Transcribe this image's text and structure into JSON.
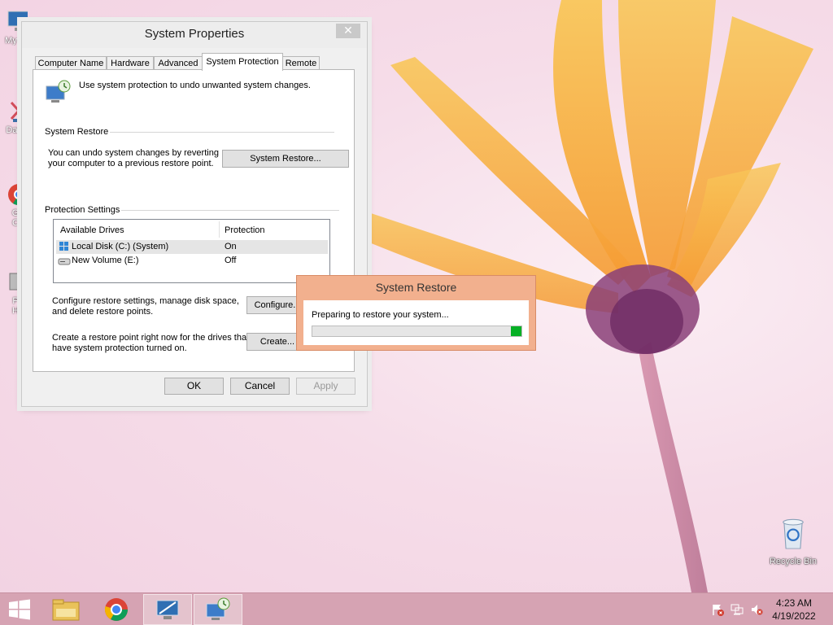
{
  "desktop": {
    "left_icons": [
      "My C",
      "Data",
      "G",
      "C",
      "P",
      "H"
    ],
    "recycle_bin_label": "Recycle Bin"
  },
  "system_properties": {
    "title": "System Properties",
    "close_glyph": "✕",
    "tabs": [
      {
        "label": "Computer Name",
        "active": false
      },
      {
        "label": "Hardware",
        "active": false
      },
      {
        "label": "Advanced",
        "active": false
      },
      {
        "label": "System Protection",
        "active": true
      },
      {
        "label": "Remote",
        "active": false
      }
    ],
    "intro_text": "Use system protection to undo unwanted system changes.",
    "system_restore_group": "System Restore",
    "system_restore_desc_line1": "You can undo system changes by reverting",
    "system_restore_desc_line2": "your computer to a previous restore point.",
    "system_restore_button": "System Restore...",
    "protection_group": "Protection Settings",
    "drive_columns": [
      "Available Drives",
      "Protection"
    ],
    "drives": [
      {
        "name": "Local Disk (C:) (System)",
        "protection": "On",
        "selected": true
      },
      {
        "name": "New Volume (E:)",
        "protection": "Off",
        "selected": false
      }
    ],
    "configure_desc_line1": "Configure restore settings, manage disk space,",
    "configure_desc_line2": "and delete restore points.",
    "configure_button": "Configure...",
    "create_desc_line1": "Create a restore point right now for the drives that",
    "create_desc_line2": "have system protection turned on.",
    "create_button": "Create...",
    "ok_button": "OK",
    "cancel_button": "Cancel",
    "apply_button": "Apply"
  },
  "restore_dialog": {
    "title": "System Restore",
    "message": "Preparing to restore your system...",
    "progress_fraction": 0.05
  },
  "taskbar": {
    "time": "4:23 AM",
    "date": "4/19/2022"
  },
  "colors": {
    "accent_dialog": "#f2b08e",
    "taskbar": "#d6a3b3",
    "progress": "#06b025"
  }
}
